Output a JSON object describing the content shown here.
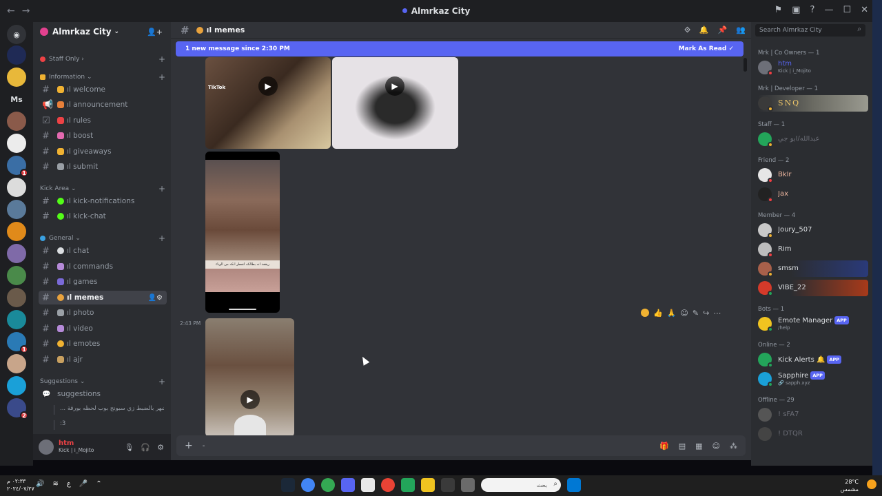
{
  "window": {
    "title": "Almrkaz City"
  },
  "server": {
    "name": "Almrkaz City"
  },
  "rail": {
    "home_initials": "Ms",
    "servers": [
      {
        "color": "#1f2a55",
        "badge": ""
      },
      {
        "color": "#e8b83a",
        "badge": ""
      },
      {
        "color": "#8a5a4a",
        "badge": ""
      },
      {
        "color": "#ececec",
        "badge": ""
      },
      {
        "color": "#3a6ea5",
        "badge": "1"
      },
      {
        "color": "#dcdcdc",
        "badge": ""
      },
      {
        "color": "#5a7a9a",
        "badge": ""
      },
      {
        "color": "#e08a1a",
        "badge": ""
      },
      {
        "color": "#7f6aa8",
        "badge": ""
      },
      {
        "color": "#4a8a4a",
        "badge": ""
      },
      {
        "color": "#6a5a4a",
        "badge": ""
      },
      {
        "color": "#1a8a9a",
        "badge": ""
      },
      {
        "color": "#2a7ab5",
        "badge": "1"
      },
      {
        "color": "#c8a58a",
        "badge": ""
      },
      {
        "color": "#1aa0d8",
        "badge": ""
      },
      {
        "color": "#3a4a8a",
        "badge": "2"
      }
    ]
  },
  "sidebar": {
    "categories": {
      "staff": "Staff Only",
      "information": "Information",
      "kick": "Kick Area",
      "general": "General",
      "suggestions": "Suggestions"
    },
    "channels": {
      "welcome": "ıl welcome",
      "announcement": "ıl announcement",
      "rules": "ıl rules",
      "boost": "ıl boost",
      "giveaways": "ıl giveaways",
      "submit": "ıl submit",
      "kick_notifications": "ıl kick-notifications",
      "kick_chat": "ıl kick-chat",
      "chat": "ıl chat",
      "commands": "ıl commands",
      "games": "ıl games",
      "memes": "ıl memes",
      "photo": "ıl photo",
      "video": "ıl video",
      "emotes": "ıl emotes",
      "ajr": "ıl ajr",
      "suggestions": "suggestions"
    },
    "threads": [
      "... موظف الشهر بالضبط زي سبونج بوب لحظه بورقة",
      ":3"
    ]
  },
  "user": {
    "name": "htm",
    "status": "Kick | i_Mojito"
  },
  "chat": {
    "channel": "ıl memes",
    "new_message_bar": "1 new message since 2:30 PM",
    "mark_as_read": "Mark As Read",
    "timestamp": "2:43 PM",
    "tiktok_label": "TikTok",
    "caption": "ريقفد انه بطالكه انفطر انكه من الوباء"
  },
  "members": {
    "search_placeholder": "Search Almrkaz City",
    "groups": [
      {
        "title": "Mrk | Co Owners — 1",
        "members": [
          {
            "name": "htm",
            "sub": "Kick | i_Mojito",
            "color": "#5865f2",
            "av": "#6d6f78",
            "status": "#f23f43"
          }
        ]
      },
      {
        "title": "Mrk | Developer — 1",
        "members": [
          {
            "name": "SNQ",
            "sub": "",
            "color": "#f0c86a",
            "av": "#3a3a3a",
            "status": "#f0b232"
          }
        ]
      },
      {
        "title": "Staff — 1",
        "members": [
          {
            "name": "عبدالله/ابو جي",
            "sub": "",
            "color": "#6d6f78",
            "av": "#23a55a",
            "status": "#f0b232"
          }
        ]
      },
      {
        "title": "Friend — 2",
        "members": [
          {
            "name": "Bklr",
            "sub": "",
            "color": "#f0b8a0",
            "av": "#e6e6e6",
            "status": "#f23f43"
          },
          {
            "name": "Jax",
            "sub": "",
            "color": "#f0b8a0",
            "av": "#222222",
            "status": "#f23f43"
          }
        ]
      },
      {
        "title": "Member — 4",
        "members": [
          {
            "name": "Joury_507",
            "sub": "",
            "color": "#dbdee1",
            "av": "#c9c9c9",
            "status": "#f0b232"
          },
          {
            "name": "Rim",
            "sub": "",
            "color": "#dbdee1",
            "av": "#bdbdbd",
            "status": "#f23f43"
          },
          {
            "name": "smsm",
            "sub": "",
            "color": "#dbdee1",
            "av": "#a8604a",
            "status": "#f0b232"
          },
          {
            "name": "VIBE_22",
            "sub": "",
            "color": "#dbdee1",
            "av": "#d43a2a",
            "status": "#23a55a"
          }
        ]
      },
      {
        "title": "Bots — 1",
        "members": [
          {
            "name": "Emote Manager",
            "sub": "/help",
            "color": "#dbdee1",
            "av": "#f0c420",
            "status": "#23a55a",
            "app": "APP"
          }
        ]
      },
      {
        "title": "Online — 2",
        "members": [
          {
            "name": "Kick Alerts 🔔",
            "sub": "",
            "color": "#dbdee1",
            "av": "#23a55a",
            "status": "#23a55a",
            "app": "APP"
          },
          {
            "name": "Sapphire",
            "sub": "🔗 sapph.xyz",
            "color": "#dbdee1",
            "av": "#1aa0d8",
            "status": "#23a55a",
            "app": "APP"
          }
        ]
      },
      {
        "title": "Offline — 29",
        "members": [
          {
            "name": "! sFA7",
            "sub": "",
            "color": "#6d6f78",
            "av": "#555555",
            "status": ""
          },
          {
            "name": "! DTQR",
            "sub": "",
            "color": "#6d6f78",
            "av": "#444444",
            "status": ""
          }
        ]
      }
    ]
  },
  "taskbar": {
    "time": "٠٢:٣٣ م",
    "date": "٢٠٢٤/٠٧/٢٧",
    "lang": "ع",
    "search_text": "بحث",
    "temp": "28°C",
    "weather": "مشمس"
  },
  "colors": {
    "accent": "#5865f2",
    "danger": "#ed4245",
    "online": "#23a55a",
    "idle": "#f0b232"
  }
}
